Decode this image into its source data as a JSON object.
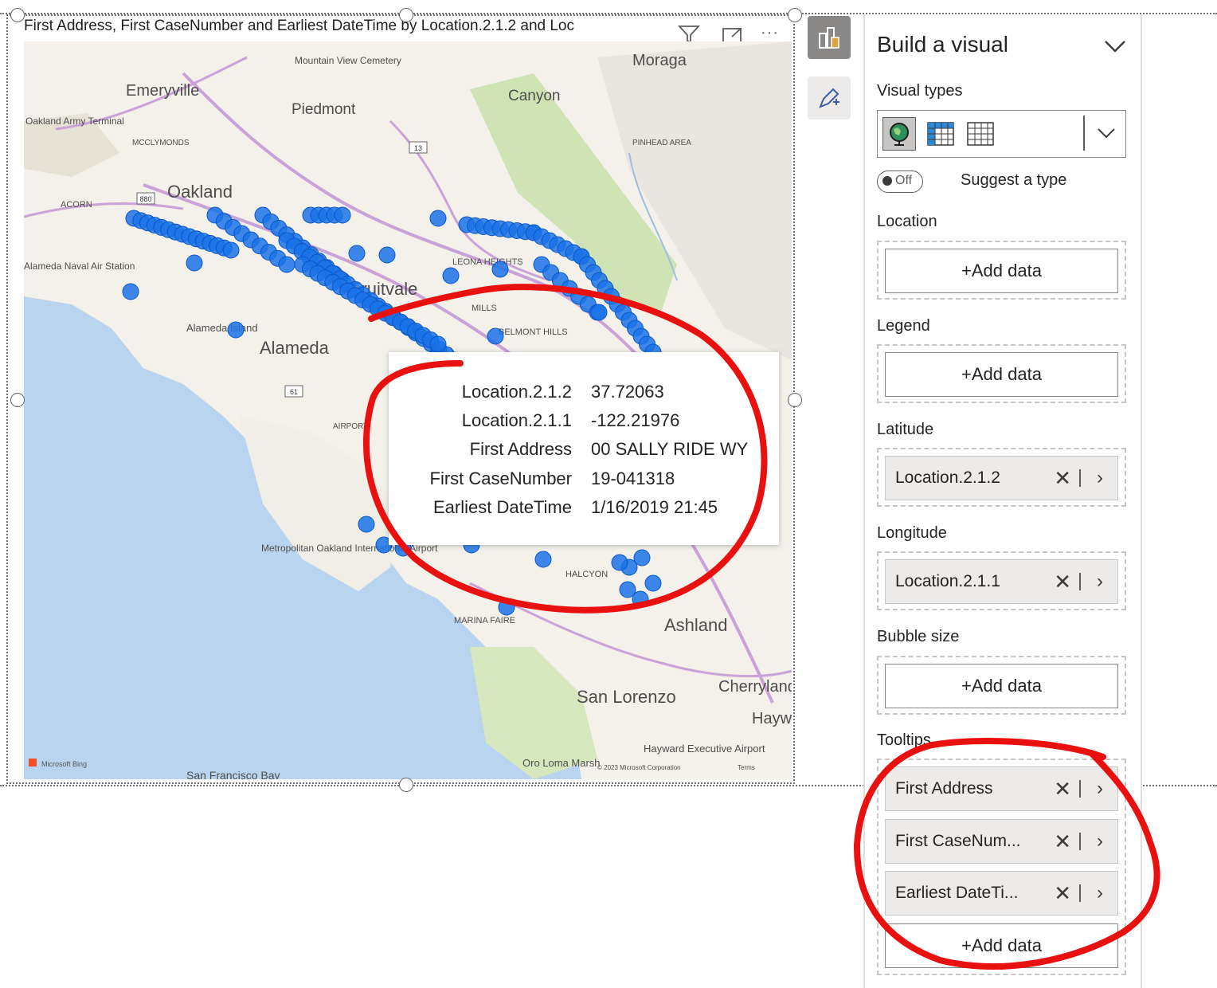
{
  "visual": {
    "title": "First Address, First CaseNumber and Earliest DateTime by Location.2.1.2 and Loc",
    "header_icons": [
      "filter-icon",
      "focus-mode-icon",
      "more-options-icon"
    ],
    "more_label": "···"
  },
  "map": {
    "place_labels": [
      "Emeryville",
      "Mountain View Cemetery",
      "Moraga",
      "Piedmont",
      "Canyon",
      "Oakland Army Terminal",
      "MCCLYMONDS",
      "PINHEAD AREA",
      "Oakland",
      "ACORN",
      "Alameda Naval Air Station",
      "Fruitvale",
      "LEONA HEIGHTS",
      "MILLS",
      "Alameda Island",
      "Alameda",
      "BELMONT HILLS",
      "AIRPORT",
      "Metropolitan Oakland International Airport",
      "HALCYON",
      "MARINA FAIRE",
      "Ashland",
      "San Lorenzo",
      "Cherryland",
      "Hayward",
      "Hayward Executive Airport",
      "Oro Loma Marsh",
      "San Francisco Bay",
      "© 2023 Microsoft Corporation",
      "Terms"
    ],
    "bing_logo": "Microsoft Bing",
    "road_shields": [
      "880",
      "13",
      "61"
    ],
    "colors": {
      "water": "#b9d4ee",
      "land": "#f3f1ea",
      "park": "#cfe3b4",
      "road": "#c9a2d8",
      "point": "#1a73e8"
    }
  },
  "tooltip": {
    "rows": [
      {
        "key": "Location.2.1.2",
        "value": "37.72063"
      },
      {
        "key": "Location.2.1.1",
        "value": "-122.21976"
      },
      {
        "key": "First Address",
        "value": "00 SALLY RIDE WY"
      },
      {
        "key": "First CaseNumber",
        "value": "19-041318"
      },
      {
        "key": "Earliest DateTime",
        "value": "1/16/2019 21:45"
      }
    ]
  },
  "side_buttons": [
    "build-visual-icon",
    "format-visual-icon"
  ],
  "pane": {
    "title": "Build a visual",
    "visual_types_label": "Visual types",
    "visual_types": [
      "map-icon",
      "matrix-icon",
      "table-icon"
    ],
    "suggest_toggle": "Off",
    "suggest_label": "Suggest a type",
    "wells": {
      "location": {
        "label": "Location",
        "add": "+Add data"
      },
      "legend": {
        "label": "Legend",
        "add": "+Add data"
      },
      "latitude": {
        "label": "Latitude",
        "field": "Location.2.1.2"
      },
      "longitude": {
        "label": "Longitude",
        "field": "Location.2.1.1"
      },
      "bubble_size": {
        "label": "Bubble size",
        "add": "+Add data"
      },
      "tooltips": {
        "label": "Tooltips",
        "fields": [
          "First Address",
          "First CaseNum...",
          "Earliest DateTi..."
        ],
        "add": "+Add data"
      }
    }
  },
  "annotation_color": "#e8110f"
}
